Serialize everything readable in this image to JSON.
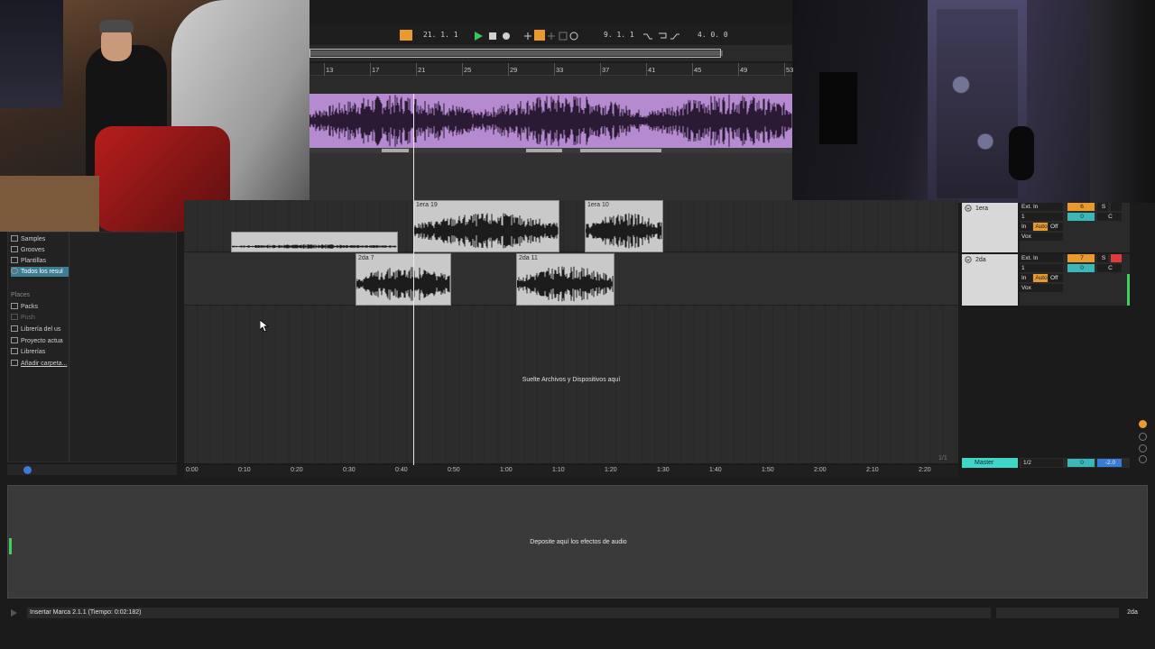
{
  "transport": {
    "position": "21.  1.  1",
    "loop_start": "9.  1.  1",
    "loop_length": "4.  0.  0"
  },
  "ruler": {
    "bars": [
      "13",
      "17",
      "21",
      "25",
      "29",
      "33",
      "37",
      "41",
      "45",
      "49",
      "53"
    ]
  },
  "browser": {
    "categories": [
      "Samples",
      "Grooves",
      "Plantillas",
      "Todos los resul"
    ],
    "places_header": "Places",
    "places": [
      "Packs",
      "Push",
      "Librería del us",
      "Proyecto actua",
      "Librerías",
      "Añadir carpeta..."
    ]
  },
  "arrangement": {
    "tracks": [
      {
        "name": "1era",
        "clips": [
          "1era 19",
          "1era 10"
        ]
      },
      {
        "name": "2da",
        "clips": [
          "2da 7",
          "2da 11"
        ]
      }
    ],
    "drop_text": "Suelte Archivos y Dispositivos aquí",
    "time_labels": [
      "0:00",
      "0:10",
      "0:20",
      "0:30",
      "0:40",
      "0:50",
      "1:00",
      "1:10",
      "1:20",
      "1:30",
      "1:40",
      "1:50",
      "2:00",
      "2:10",
      "2:20"
    ],
    "page_indicator": "1/1"
  },
  "mixer": {
    "input": "Ext. In",
    "channel": "1",
    "monitor_in": "In",
    "monitor_auto": "Auto",
    "monitor_off": "Off",
    "output": "Vox",
    "track1_num": "6",
    "track2_num": "7",
    "solo": "S",
    "vol": "0",
    "pan": "C",
    "master_name": "Master",
    "master_out": "1/2",
    "master_vol": "0",
    "master_peak": "-2.0"
  },
  "devices": {
    "drop_text": "Deposite aquí los efectos de audio"
  },
  "status": {
    "text": "Insertar Marca 2.1.1 (Tiempo: 0:02:182)",
    "selected_track": "2da"
  },
  "colors": {
    "accent_orange": "#e89a2f",
    "accent_teal": "#3bb7b9",
    "clip_purple": "#b68ad0",
    "play_green": "#38c95a"
  }
}
